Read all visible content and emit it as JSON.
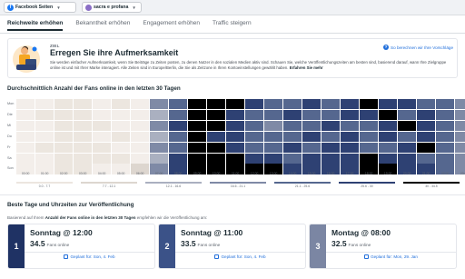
{
  "topbar": {
    "page_selector": "Facebook Seiten",
    "account_selector": "sacra e profana"
  },
  "tabs": [
    {
      "label": "Reichweite erhöhen",
      "active": true
    },
    {
      "label": "Bekanntheit erhöhen",
      "active": false
    },
    {
      "label": "Engagement erhöhen",
      "active": false
    },
    {
      "label": "Traffic steigern",
      "active": false
    }
  ],
  "goal_card": {
    "eyebrow": "ZIEL",
    "title": "Erregen Sie ihre Aufmerksamkeit",
    "description": "Sie werden einfacher Aufmerksamkeit, wenn Sie Beiträge zu Zeiten posten, zu denen Nutzer in den sozialen Medien aktiv sind. Schauen Sie, welche Veröffentlichungszeiten am besten sind, basierend darauf, wann Ihre Zielgruppe online ist und mit Ihrer Marke interagiert. Alle Zeiten sind in Europe/Berlin, die Sie als Zeitzone in Ihren Kontoeinstellungen gewählt haben.",
    "more_link": "Erfahren Sie mehr",
    "calc_link": "So berechnen wir Ihre Vorschläge"
  },
  "heatmap": {
    "title": "Durchschnittlich Anzahl der Fans online in den letzten 30 Tagen",
    "days": [
      "Mon",
      "Die",
      "Mi",
      "Do",
      "Fr",
      "Sa",
      "Son"
    ],
    "hours": [
      "00:00",
      "01:00",
      "02:00",
      "03:00",
      "04:00",
      "05:00",
      "06:00",
      "07:00",
      "08:00",
      "09:00",
      "10:00",
      "11:00",
      "12:00",
      "13:00",
      "14:00",
      "15:00",
      "16:00",
      "17:00",
      "18:00",
      "19:00",
      "20:00",
      "21:00",
      "22:00",
      "23:00"
    ],
    "levels": [
      [
        1,
        1,
        0,
        0,
        1,
        0,
        1,
        4,
        5,
        7,
        7,
        7,
        6,
        5,
        5,
        6,
        5,
        6,
        7,
        6,
        6,
        5,
        5,
        4
      ],
      [
        1,
        0,
        0,
        0,
        1,
        1,
        1,
        3,
        5,
        7,
        7,
        6,
        5,
        5,
        6,
        5,
        5,
        6,
        6,
        7,
        5,
        6,
        5,
        4
      ],
      [
        1,
        1,
        0,
        0,
        0,
        1,
        1,
        4,
        6,
        7,
        7,
        6,
        5,
        4,
        5,
        5,
        6,
        5,
        5,
        6,
        7,
        6,
        5,
        4
      ],
      [
        1,
        1,
        0,
        0,
        1,
        0,
        1,
        3,
        5,
        7,
        6,
        6,
        5,
        5,
        5,
        6,
        5,
        6,
        5,
        6,
        5,
        6,
        5,
        4
      ],
      [
        1,
        0,
        0,
        0,
        0,
        1,
        1,
        4,
        5,
        7,
        7,
        6,
        5,
        5,
        6,
        5,
        6,
        6,
        5,
        5,
        6,
        7,
        5,
        4
      ],
      [
        1,
        1,
        0,
        0,
        0,
        0,
        1,
        3,
        6,
        7,
        7,
        7,
        6,
        6,
        5,
        6,
        6,
        6,
        7,
        6,
        6,
        5,
        5,
        4
      ],
      [
        1,
        1,
        0,
        0,
        1,
        1,
        2,
        4,
        6,
        7,
        7,
        7,
        7,
        7,
        6,
        6,
        6,
        6,
        7,
        7,
        6,
        6,
        5,
        4
      ]
    ],
    "scale": [
      {
        "label": "0.0 - 7.7",
        "color": "#ece6df"
      },
      {
        "label": "7.7 - 12.1",
        "color": "#ddd6cf"
      },
      {
        "label": "12.1 - 16.6",
        "color": "#aab0c0"
      },
      {
        "label": "16.6 - 21.1",
        "color": "#7f8aa6"
      },
      {
        "label": "21.1 - 25.6",
        "color": "#55678f"
      },
      {
        "label": "25.6 - 30",
        "color": "#2e4173"
      },
      {
        "label": "30 - 34.5",
        "color": "#000000"
      }
    ],
    "level_colors": [
      "#ece6df",
      "#f3eeea",
      "#ddd6cf",
      "#aab0c0",
      "#7f8aa6",
      "#55678f",
      "#2e4173",
      "#000000"
    ]
  },
  "best_times": {
    "title": "Beste Tage und Uhrzeiten zur Veröffentlichung",
    "subtitle_prefix": "Basierend auf Ihrem",
    "subtitle_bold": "Anzahl der Fans online in den letzten 30 Tagen",
    "subtitle_suffix": "empfehlen wir die Veröffentlichung am:",
    "fans_label": "Fans online",
    "items": [
      {
        "rank": "1",
        "slot": "Sonntag @ 12:00",
        "value": "34.5",
        "plan": "Geplant für: Son, 4. Feb",
        "color": "#1f3264"
      },
      {
        "rank": "2",
        "slot": "Sonntag @ 11:00",
        "value": "33.5",
        "plan": "Geplant für: Son, 4. Feb",
        "color": "#3b5288"
      },
      {
        "rank": "3",
        "slot": "Montag @ 08:00",
        "value": "32.5",
        "plan": "Geplant für: Mon, 29. Jan",
        "color": "#7b86a3"
      }
    ]
  }
}
